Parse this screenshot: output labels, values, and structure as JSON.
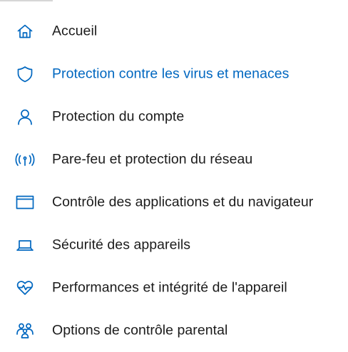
{
  "accent_color": "#0067c0",
  "nav": {
    "items": [
      {
        "label": "Accueil",
        "icon": "home-icon",
        "active": false
      },
      {
        "label": "Protection contre les virus et menaces",
        "icon": "shield-icon",
        "active": true
      },
      {
        "label": "Protection du compte",
        "icon": "person-icon",
        "active": false
      },
      {
        "label": "Pare-feu et protection du réseau",
        "icon": "wireless-antenna-icon",
        "active": false
      },
      {
        "label": "Contrôle des applications et du navigateur",
        "icon": "app-window-icon",
        "active": false
      },
      {
        "label": "Sécurité des appareils",
        "icon": "laptop-icon",
        "active": false
      },
      {
        "label": "Performances et intégrité de l'appareil",
        "icon": "heart-pulse-icon",
        "active": false
      },
      {
        "label": "Options de contrôle parental",
        "icon": "family-icon",
        "active": false
      }
    ]
  }
}
